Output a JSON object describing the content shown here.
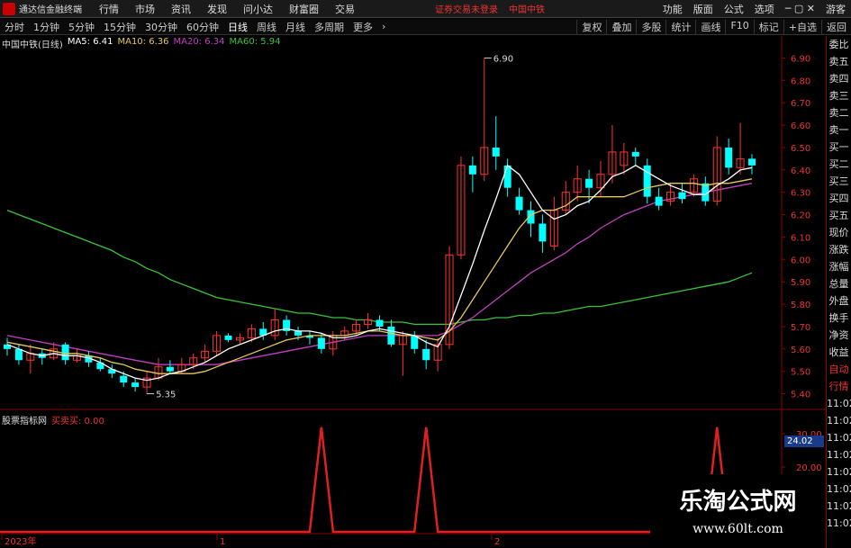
{
  "app": {
    "title": "通达信金融终端",
    "menus": [
      "行情",
      "市场",
      "资讯",
      "发现",
      "问小达",
      "财富圈",
      "交易"
    ],
    "notice": "证券交易未登录",
    "stock": "中国中铁",
    "right_menus": [
      "功能",
      "版面",
      "公式",
      "选项"
    ],
    "guest": "游客"
  },
  "toolbar": {
    "timeframes": [
      "分时",
      "1分钟",
      "5分钟",
      "15分钟",
      "30分钟",
      "60分钟",
      "日线",
      "周线",
      "月线",
      "多周期",
      "更多"
    ],
    "active": "日线",
    "right": [
      "复权",
      "叠加",
      "多股",
      "统计",
      "画线",
      "F10",
      "标记",
      "+自选",
      "返回"
    ]
  },
  "legend": {
    "name": "中国中铁(日线)",
    "ma5": "MA5: 6.41",
    "ma10": "MA10: 6.36",
    "ma20": "MA20: 6.34",
    "ma60": "MA60: 5.94"
  },
  "indicator": {
    "name": "股票指标网",
    "label": "买卖买: 0.00",
    "box_value": "24.02"
  },
  "sidebar": [
    "委比",
    "卖五",
    "卖四",
    "卖三",
    "卖二",
    "卖一",
    "买一",
    "买二",
    "买三",
    "买四",
    "买五",
    "现价",
    "涨跌",
    "涨幅",
    "总量",
    "外盘",
    "换手",
    "净资",
    "收益",
    "自动",
    "行情",
    "11:02",
    "11:02",
    "11:02",
    "11:02",
    "11:02",
    "11:02",
    "11:02",
    "11:02"
  ],
  "watermark": {
    "line1": "乐淘公式网",
    "line2": "www.60lt.com"
  },
  "chart_data": {
    "type": "candlestick",
    "y_ticks": [
      "6.90",
      "6.80",
      "6.70",
      "6.60",
      "6.50",
      "6.40",
      "6.30",
      "6.20",
      "6.10",
      "6.00",
      "5.90",
      "5.80",
      "5.70",
      "5.60",
      "5.50",
      "5.40"
    ],
    "ylim": [
      5.35,
      6.95
    ],
    "annotations": {
      "high": "6.90",
      "low": "5.35"
    },
    "x_labels": [
      "2023年",
      "1",
      "2"
    ],
    "indicator_ticks": [
      "30.00",
      "20.00"
    ],
    "candles": [
      [
        5.62,
        5.6,
        5.65,
        5.57
      ],
      [
        5.6,
        5.55,
        5.62,
        5.53
      ],
      [
        5.55,
        5.58,
        5.62,
        5.49
      ],
      [
        5.58,
        5.56,
        5.6,
        5.53
      ],
      [
        5.56,
        5.6,
        5.63,
        5.55
      ],
      [
        5.62,
        5.55,
        5.63,
        5.53
      ],
      [
        5.55,
        5.57,
        5.6,
        5.54
      ],
      [
        5.57,
        5.54,
        5.59,
        5.52
      ],
      [
        5.54,
        5.51,
        5.56,
        5.5
      ],
      [
        5.51,
        5.49,
        5.53,
        5.47
      ],
      [
        5.48,
        5.45,
        5.5,
        5.43
      ],
      [
        5.45,
        5.43,
        5.47,
        5.41
      ],
      [
        5.43,
        5.47,
        5.5,
        5.4
      ],
      [
        5.47,
        5.52,
        5.56,
        5.46
      ],
      [
        5.52,
        5.5,
        5.55,
        5.49
      ],
      [
        5.5,
        5.53,
        5.56,
        5.49
      ],
      [
        5.53,
        5.56,
        5.58,
        5.51
      ],
      [
        5.56,
        5.59,
        5.62,
        5.54
      ],
      [
        5.59,
        5.66,
        5.68,
        5.57
      ],
      [
        5.66,
        5.64,
        5.67,
        5.63
      ],
      [
        5.64,
        5.65,
        5.67,
        5.62
      ],
      [
        5.65,
        5.69,
        5.71,
        5.63
      ],
      [
        5.69,
        5.66,
        5.72,
        5.64
      ],
      [
        5.66,
        5.73,
        5.78,
        5.64
      ],
      [
        5.73,
        5.68,
        5.75,
        5.66
      ],
      [
        5.68,
        5.66,
        5.7,
        5.64
      ],
      [
        5.66,
        5.65,
        5.68,
        5.62
      ],
      [
        5.65,
        5.6,
        5.67,
        5.58
      ],
      [
        5.6,
        5.66,
        5.68,
        5.57
      ],
      [
        5.66,
        5.68,
        5.7,
        5.64
      ],
      [
        5.68,
        5.71,
        5.73,
        5.66
      ],
      [
        5.71,
        5.73,
        5.76,
        5.69
      ],
      [
        5.73,
        5.7,
        5.75,
        5.68
      ],
      [
        5.7,
        5.62,
        5.73,
        5.61
      ],
      [
        5.62,
        5.66,
        5.68,
        5.48
      ],
      [
        5.66,
        5.6,
        5.68,
        5.58
      ],
      [
        5.6,
        5.55,
        5.64,
        5.51
      ],
      [
        5.55,
        5.62,
        5.65,
        5.5
      ],
      [
        5.62,
        6.02,
        6.06,
        5.6
      ],
      [
        6.02,
        6.42,
        6.46,
        6.0
      ],
      [
        6.42,
        6.38,
        6.46,
        6.3
      ],
      [
        6.38,
        6.5,
        6.9,
        6.35
      ],
      [
        6.5,
        6.46,
        6.64,
        6.4
      ],
      [
        6.42,
        6.32,
        6.45,
        6.28
      ],
      [
        6.28,
        6.22,
        6.32,
        6.2
      ],
      [
        6.22,
        6.16,
        6.26,
        6.1
      ],
      [
        6.16,
        6.08,
        6.2,
        6.03
      ],
      [
        6.06,
        6.22,
        6.28,
        6.04
      ],
      [
        6.22,
        6.3,
        6.35,
        6.2
      ],
      [
        6.3,
        6.36,
        6.42,
        6.26
      ],
      [
        6.36,
        6.32,
        6.4,
        6.25
      ],
      [
        6.32,
        6.38,
        6.44,
        6.28
      ],
      [
        6.38,
        6.48,
        6.6,
        6.34
      ],
      [
        6.42,
        6.48,
        6.52,
        6.38
      ],
      [
        6.48,
        6.46,
        6.5,
        6.42
      ],
      [
        6.42,
        6.28,
        6.45,
        6.25
      ],
      [
        6.28,
        6.24,
        6.32,
        6.22
      ],
      [
        6.26,
        6.3,
        6.34,
        6.24
      ],
      [
        6.3,
        6.27,
        6.34,
        6.25
      ],
      [
        6.3,
        6.36,
        6.38,
        6.28
      ],
      [
        6.34,
        6.26,
        6.37,
        6.24
      ],
      [
        6.26,
        6.5,
        6.55,
        6.24
      ],
      [
        6.5,
        6.41,
        6.54,
        6.38
      ],
      [
        6.41,
        6.45,
        6.61,
        6.38
      ],
      [
        6.45,
        6.42,
        6.47,
        6.38
      ]
    ],
    "ma5": [
      5.62,
      5.6,
      5.58,
      5.57,
      5.58,
      5.57,
      5.57,
      5.56,
      5.54,
      5.51,
      5.49,
      5.47,
      5.46,
      5.47,
      5.49,
      5.5,
      5.52,
      5.54,
      5.57,
      5.6,
      5.62,
      5.64,
      5.66,
      5.68,
      5.69,
      5.68,
      5.68,
      5.67,
      5.65,
      5.65,
      5.66,
      5.68,
      5.69,
      5.68,
      5.67,
      5.66,
      5.63,
      5.61,
      5.7,
      5.84,
      5.98,
      6.13,
      6.27,
      6.42,
      6.38,
      6.3,
      6.22,
      6.18,
      6.2,
      6.24,
      6.26,
      6.31,
      6.37,
      6.39,
      6.42,
      6.39,
      6.36,
      6.33,
      6.31,
      6.29,
      6.29,
      6.33,
      6.36,
      6.4,
      6.41
    ],
    "ma10": [
      5.63,
      5.62,
      5.61,
      5.6,
      5.59,
      5.58,
      5.58,
      5.57,
      5.56,
      5.54,
      5.53,
      5.51,
      5.5,
      5.49,
      5.49,
      5.49,
      5.49,
      5.5,
      5.52,
      5.54,
      5.56,
      5.58,
      5.6,
      5.62,
      5.64,
      5.65,
      5.66,
      5.66,
      5.66,
      5.66,
      5.67,
      5.68,
      5.68,
      5.67,
      5.66,
      5.66,
      5.65,
      5.64,
      5.68,
      5.74,
      5.82,
      5.9,
      5.98,
      6.06,
      6.14,
      6.2,
      6.22,
      6.22,
      6.24,
      6.28,
      6.28,
      6.28,
      6.28,
      6.28,
      6.3,
      6.32,
      6.33,
      6.34,
      6.34,
      6.34,
      6.33,
      6.34,
      6.34,
      6.35,
      6.36
    ],
    "ma20": [
      5.66,
      5.65,
      5.64,
      5.63,
      5.62,
      5.61,
      5.6,
      5.59,
      5.58,
      5.57,
      5.56,
      5.55,
      5.54,
      5.53,
      5.53,
      5.53,
      5.53,
      5.53,
      5.53,
      5.54,
      5.55,
      5.56,
      5.57,
      5.58,
      5.59,
      5.6,
      5.61,
      5.62,
      5.63,
      5.64,
      5.65,
      5.66,
      5.66,
      5.66,
      5.66,
      5.66,
      5.66,
      5.66,
      5.68,
      5.71,
      5.74,
      5.78,
      5.82,
      5.86,
      5.9,
      5.94,
      5.97,
      6.0,
      6.03,
      6.07,
      6.1,
      6.14,
      6.17,
      6.2,
      6.22,
      6.24,
      6.26,
      6.27,
      6.28,
      6.29,
      6.3,
      6.31,
      6.32,
      6.33,
      6.34
    ],
    "ma60": [
      6.22,
      6.2,
      6.18,
      6.16,
      6.14,
      6.12,
      6.1,
      6.08,
      6.06,
      6.04,
      6.01,
      5.99,
      5.96,
      5.94,
      5.91,
      5.89,
      5.87,
      5.85,
      5.83,
      5.82,
      5.81,
      5.8,
      5.79,
      5.78,
      5.77,
      5.76,
      5.76,
      5.75,
      5.74,
      5.74,
      5.73,
      5.73,
      5.72,
      5.72,
      5.72,
      5.71,
      5.71,
      5.71,
      5.71,
      5.72,
      5.73,
      5.73,
      5.74,
      5.74,
      5.75,
      5.75,
      5.76,
      5.76,
      5.77,
      5.78,
      5.79,
      5.79,
      5.8,
      5.81,
      5.82,
      5.83,
      5.84,
      5.85,
      5.86,
      5.87,
      5.88,
      5.89,
      5.9,
      5.92,
      5.94
    ],
    "signals": [
      27,
      36,
      61
    ],
    "signal_peak": 32
  },
  "colors": {
    "up": "#ff3333",
    "down": "#00ffff",
    "ma5": "#ffffff",
    "ma10": "#e6c85a",
    "ma20": "#c040c0",
    "ma60": "#3ac43a",
    "signal": "#e02020",
    "axis": "#8b0000"
  }
}
